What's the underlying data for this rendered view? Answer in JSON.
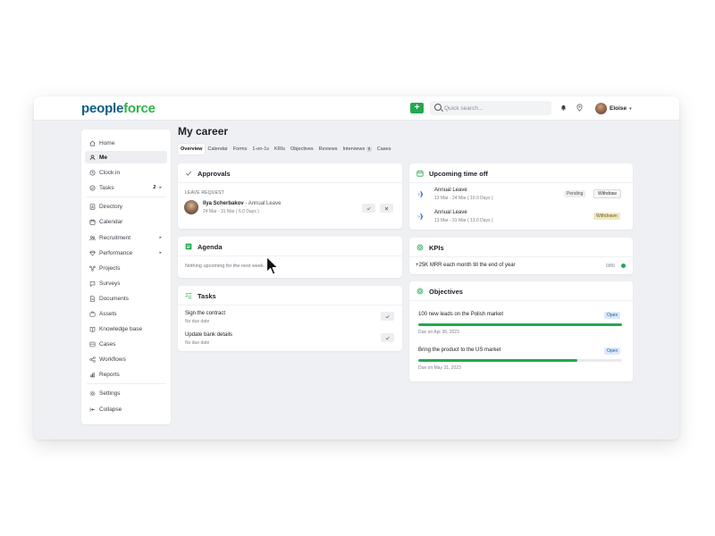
{
  "brand": {
    "logo_people": "people",
    "logo_force": "force"
  },
  "topbar": {
    "add_label": "+",
    "search_placeholder": "Quick search...",
    "user_name": "Eloise",
    "user_caret": "▾"
  },
  "sidebar": {
    "items": [
      {
        "label": "Home",
        "icon": "home-icon"
      },
      {
        "label": "Me",
        "icon": "user-icon",
        "active": true
      },
      {
        "label": "Clock in",
        "icon": "clock-icon"
      },
      {
        "label": "Tasks",
        "icon": "check-circle-icon",
        "badge": "2",
        "arrow": "▸"
      },
      {
        "label": "Directory",
        "icon": "directory-icon"
      },
      {
        "label": "Calendar",
        "icon": "calendar-icon"
      },
      {
        "label": "Recruitment",
        "icon": "recruitment-icon",
        "arrow": "▸"
      },
      {
        "label": "Performance",
        "icon": "diamond-icon",
        "arrow": "▸"
      },
      {
        "label": "Projects",
        "icon": "projects-icon"
      },
      {
        "label": "Surveys",
        "icon": "survey-icon"
      },
      {
        "label": "Documents",
        "icon": "document-icon"
      },
      {
        "label": "Assets",
        "icon": "assets-icon"
      },
      {
        "label": "Knowledge base",
        "icon": "book-icon"
      },
      {
        "label": "Cases",
        "icon": "cases-icon"
      },
      {
        "label": "Workflows",
        "icon": "workflow-icon"
      },
      {
        "label": "Reports",
        "icon": "reports-icon"
      },
      {
        "label": "Settings",
        "icon": "gear-icon"
      },
      {
        "label": "Collapse",
        "icon": "collapse-icon"
      }
    ]
  },
  "page": {
    "title": "My career"
  },
  "tabs": [
    {
      "label": "Overview",
      "active": true
    },
    {
      "label": "Calendar"
    },
    {
      "label": "Forms"
    },
    {
      "label": "1-on-1s"
    },
    {
      "label": "KRIs"
    },
    {
      "label": "Objectives"
    },
    {
      "label": "Reviews"
    },
    {
      "label": "Interviews",
      "badge": "0"
    },
    {
      "label": "Cases"
    }
  ],
  "approvals": {
    "title": "Approvals",
    "section": "LEAVE REQUEST",
    "name": "Ilya Scherbakov",
    "type": " - Annual Leave",
    "dates": "24 Mar - 31 Mar ( 6.0 Days )"
  },
  "agenda": {
    "title": "Agenda",
    "empty": "Nothing upcoming for the next week."
  },
  "tasks": {
    "title": "Tasks",
    "items": [
      {
        "title": "Sign the contract",
        "due": "No due date"
      },
      {
        "title": "Update bank details",
        "due": "No due date"
      }
    ]
  },
  "timeoff": {
    "title": "Upcoming time off",
    "items": [
      {
        "title": "Annual Leave",
        "dates": "13 Mar - 24 Mar ( 10.0 Days )",
        "status": "Pending",
        "action": "Withdraw"
      },
      {
        "title": "Annual Leave",
        "dates": "13 Mar - 31 Mar ( 13.0 Days )",
        "status": "Withdrawn"
      }
    ]
  },
  "kpis": {
    "title": "KPIs",
    "item": "+25K MRR each month till the end of year",
    "value": "0/80"
  },
  "objectives": {
    "title": "Objectives",
    "items": [
      {
        "title": "100 new leads on the Polish market",
        "status": "Open",
        "due": "Due on Apr 30, 2023",
        "progress": 1.0
      },
      {
        "title": "Bring the product to the US market",
        "status": "Open",
        "due": "Due on May 31, 2023",
        "progress": 0.78
      }
    ]
  },
  "colors": {
    "accent_green": "#22a94f",
    "brand_blue": "#0f5e82",
    "brand_green": "#2fb34a"
  }
}
